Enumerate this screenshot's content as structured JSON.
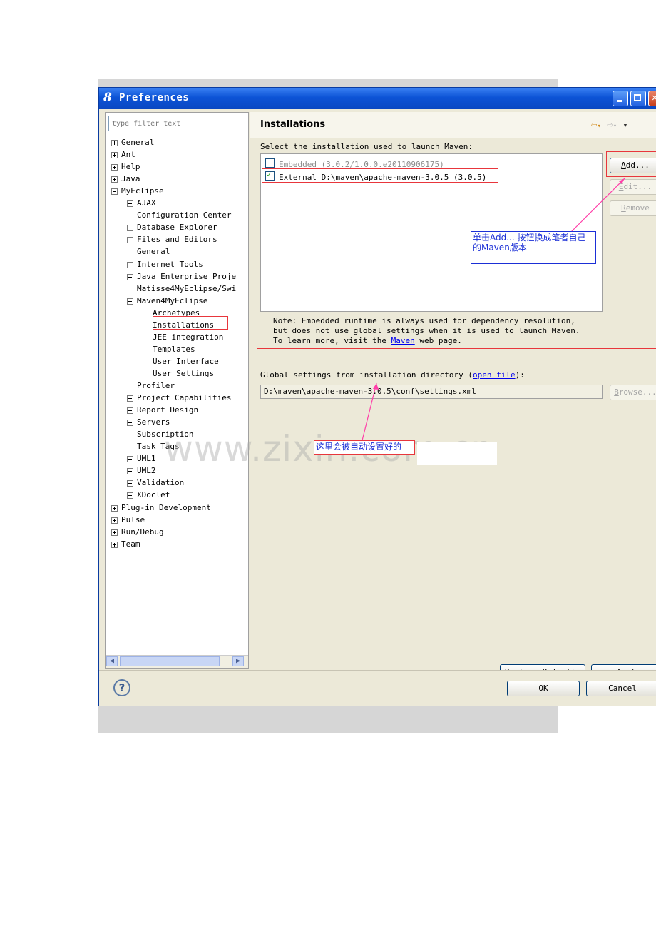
{
  "window": {
    "title": "Preferences"
  },
  "filter": {
    "placeholder": "type filter text"
  },
  "tree": [
    {
      "label": "General",
      "level": 0,
      "expander": "plus"
    },
    {
      "label": "Ant",
      "level": 0,
      "expander": "plus"
    },
    {
      "label": "Help",
      "level": 0,
      "expander": "plus"
    },
    {
      "label": "Java",
      "level": 0,
      "expander": "plus"
    },
    {
      "label": "MyEclipse",
      "level": 0,
      "expander": "minus"
    },
    {
      "label": "AJAX",
      "level": 1,
      "expander": "plus"
    },
    {
      "label": "Configuration Center",
      "level": 1,
      "expander": "none"
    },
    {
      "label": "Database Explorer",
      "level": 1,
      "expander": "plus"
    },
    {
      "label": "Files and Editors",
      "level": 1,
      "expander": "plus"
    },
    {
      "label": "General",
      "level": 1,
      "expander": "none"
    },
    {
      "label": "Internet Tools",
      "level": 1,
      "expander": "plus"
    },
    {
      "label": "Java Enterprise Proje",
      "level": 1,
      "expander": "plus"
    },
    {
      "label": "Matisse4MyEclipse/Swi",
      "level": 1,
      "expander": "none"
    },
    {
      "label": "Maven4MyEclipse",
      "level": 1,
      "expander": "minus"
    },
    {
      "label": "Archetypes",
      "level": 2,
      "expander": "none"
    },
    {
      "label": "Installations",
      "level": 2,
      "expander": "none"
    },
    {
      "label": "JEE integration",
      "level": 2,
      "expander": "none"
    },
    {
      "label": "Templates",
      "level": 2,
      "expander": "none"
    },
    {
      "label": "User Interface",
      "level": 2,
      "expander": "none"
    },
    {
      "label": "User Settings",
      "level": 2,
      "expander": "none"
    },
    {
      "label": "Profiler",
      "level": 1,
      "expander": "none"
    },
    {
      "label": "Project Capabilities",
      "level": 1,
      "expander": "plus"
    },
    {
      "label": "Report Design",
      "level": 1,
      "expander": "plus"
    },
    {
      "label": "Servers",
      "level": 1,
      "expander": "plus"
    },
    {
      "label": "Subscription",
      "level": 1,
      "expander": "none"
    },
    {
      "label": "Task Tags",
      "level": 1,
      "expander": "none"
    },
    {
      "label": "UML1",
      "level": 1,
      "expander": "plus"
    },
    {
      "label": "UML2",
      "level": 1,
      "expander": "plus"
    },
    {
      "label": "Validation",
      "level": 1,
      "expander": "plus"
    },
    {
      "label": "XDoclet",
      "level": 1,
      "expander": "plus"
    },
    {
      "label": "Plug-in Development",
      "level": 0,
      "expander": "plus"
    },
    {
      "label": "Pulse",
      "level": 0,
      "expander": "plus"
    },
    {
      "label": "Run/Debug",
      "level": 0,
      "expander": "plus"
    },
    {
      "label": "Team",
      "level": 0,
      "expander": "plus"
    }
  ],
  "page": {
    "title": "Installations",
    "select_label": "Select the installation used to launch Maven:",
    "installations": [
      {
        "label": "Embedded (3.0.2/1.0.0.e20110906175)",
        "checked": false
      },
      {
        "label": "External D:\\maven\\apache-maven-3.0.5 (3.0.5)",
        "checked": true
      }
    ],
    "add_label": "Add...",
    "edit_label": "Edit...",
    "remove_label": "Remove",
    "note_line1": "Note: Embedded runtime is always used for dependency resolution,",
    "note_line2": "but does not use global settings when it is used to launch Maven.",
    "note_line3_pre": "To learn more, visit the ",
    "note_link": "Maven",
    "note_line3_post": " web page.",
    "global_label_pre": "Global settings from installation directory (",
    "global_link": "open file",
    "global_label_post": "):",
    "settings_path": "D:\\maven\\apache-maven-3.0.5\\conf\\settings.xml",
    "browse_label": "Browse...",
    "restore_label": "Restore Defaults",
    "apply_label": "Apply"
  },
  "footer": {
    "ok_label": "OK",
    "cancel_label": "Cancel"
  },
  "annotations": {
    "callout1": "单击Add... 按钮换成笔者自己的Maven版本",
    "callout2": "这里会被自动设置好的"
  },
  "watermark": "www.zixin.com.cn",
  "colors": {
    "annotation_red": "#e8363c",
    "annotation_blue": "#1b2fd6",
    "titlebar": "#0c53d6"
  }
}
